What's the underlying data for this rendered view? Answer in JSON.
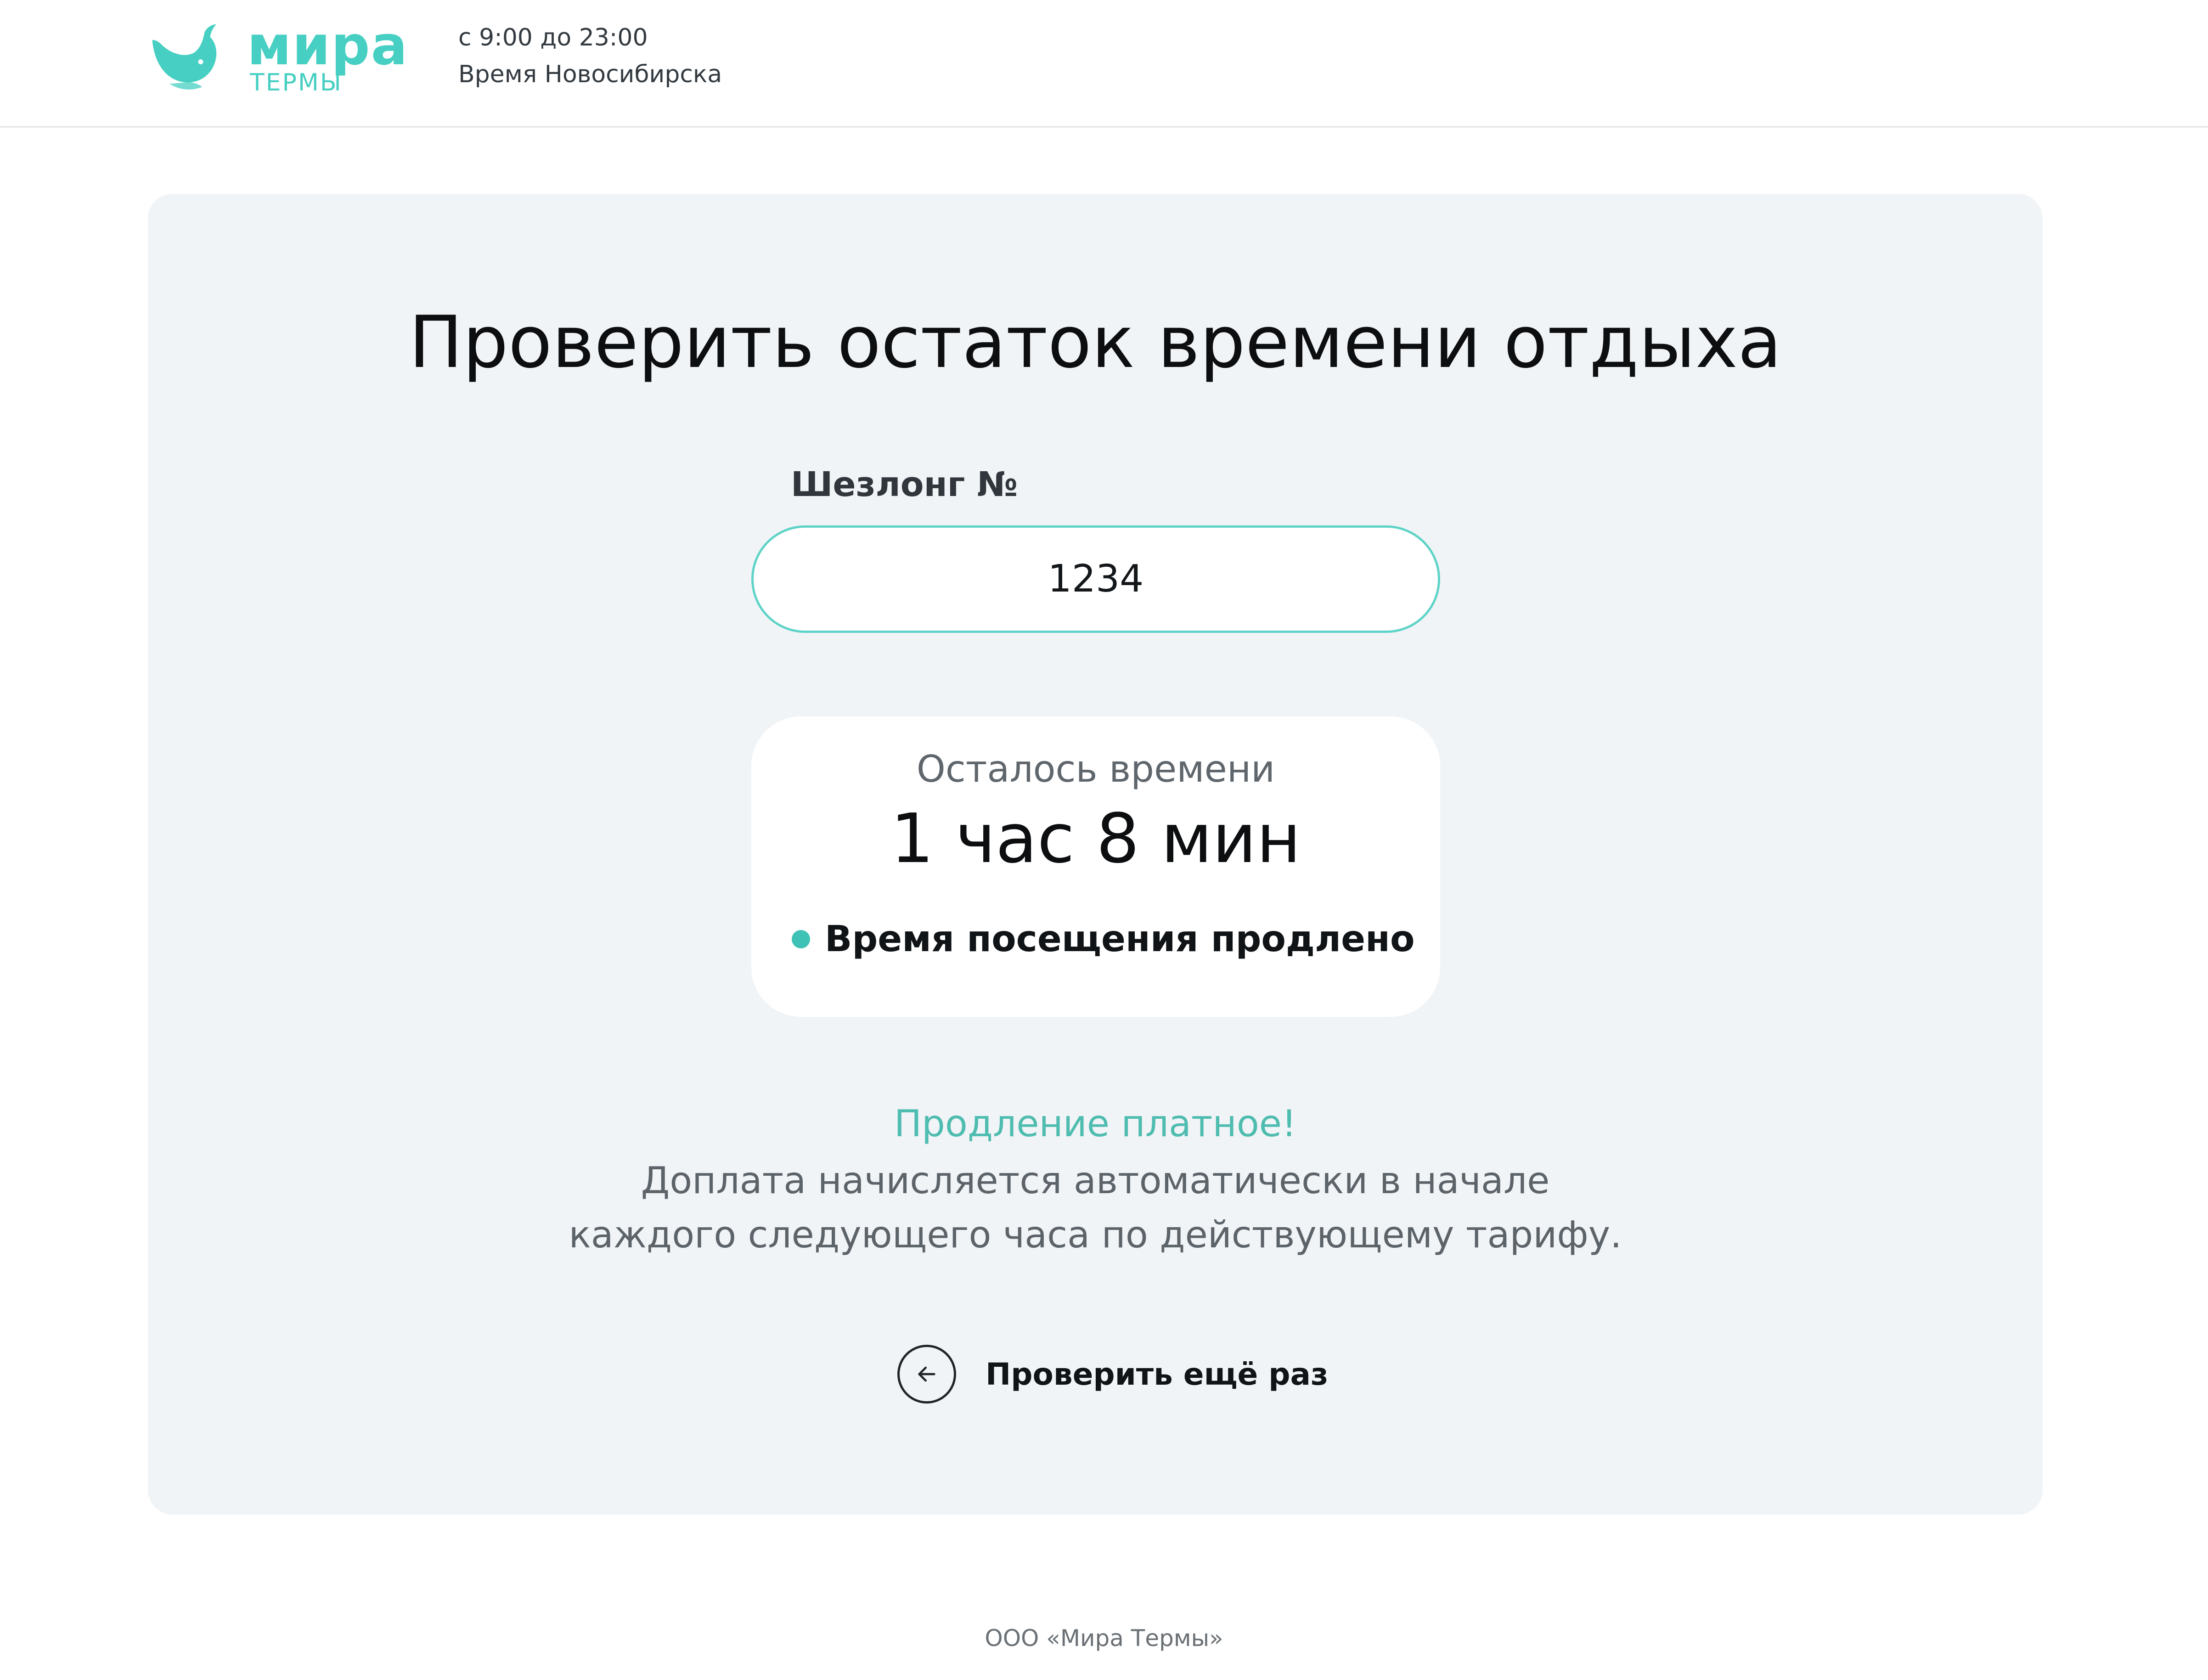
{
  "header": {
    "brand_name": "мира",
    "brand_sub": "ТЕРМЫ",
    "hours_line1": "с 9:00 до 23:00",
    "hours_line2": "Время Новосибирска",
    "logo_icon": "whale-logo-icon",
    "accent_color": "#46cfc2"
  },
  "main": {
    "title": "Проверить остаток времени отдыха",
    "field_label": "Шезлонг №",
    "field_value": "1234",
    "result": {
      "label": "Осталось времени",
      "value": "1 час 8 мин",
      "status": "Время посещения продлено",
      "status_color": "#3fc2b6"
    },
    "notice": {
      "title": "Продление платное!",
      "text": "Доплата начисляется автоматически в начале каждого следующего часа по действующему тарифу."
    },
    "retry": {
      "label": "Проверить ещё раз",
      "icon": "arrow-left-icon"
    }
  },
  "footer": {
    "company": "ООО «Мира Термы»"
  }
}
